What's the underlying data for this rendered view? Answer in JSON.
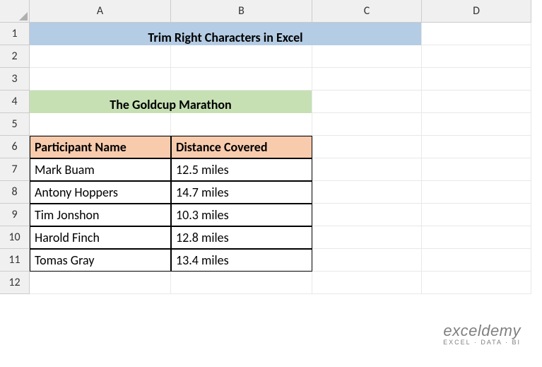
{
  "columns": [
    "A",
    "B",
    "C",
    "D"
  ],
  "rows": [
    "1",
    "2",
    "3",
    "4",
    "5",
    "6",
    "7",
    "8",
    "9",
    "10",
    "11",
    "12"
  ],
  "title": "Trim Right Characters in Excel",
  "subtitle": "The Goldcup Marathon",
  "table": {
    "headers": [
      "Participant Name",
      "Distance Covered"
    ],
    "data": [
      [
        "Mark Buam",
        "12.5 miles"
      ],
      [
        "Antony Hoppers",
        "14.7 miles"
      ],
      [
        "Tim Jonshon",
        "10.3 miles"
      ],
      [
        "Harold Finch",
        "12.8 miles"
      ],
      [
        "Tomas Gray",
        "13.4 miles"
      ]
    ]
  },
  "watermark": {
    "title": "exceldemy",
    "sub": "EXCEL · DATA · BI"
  },
  "chart_data": {
    "type": "table",
    "title": "The Goldcup Marathon",
    "columns": [
      "Participant Name",
      "Distance Covered"
    ],
    "rows": [
      {
        "Participant Name": "Mark Buam",
        "Distance Covered": "12.5 miles"
      },
      {
        "Participant Name": "Antony Hoppers",
        "Distance Covered": "14.7 miles"
      },
      {
        "Participant Name": "Tim Jonshon",
        "Distance Covered": "10.3 miles"
      },
      {
        "Participant Name": "Harold Finch",
        "Distance Covered": "12.8 miles"
      },
      {
        "Participant Name": "Tomas Gray",
        "Distance Covered": "13.4 miles"
      }
    ]
  }
}
